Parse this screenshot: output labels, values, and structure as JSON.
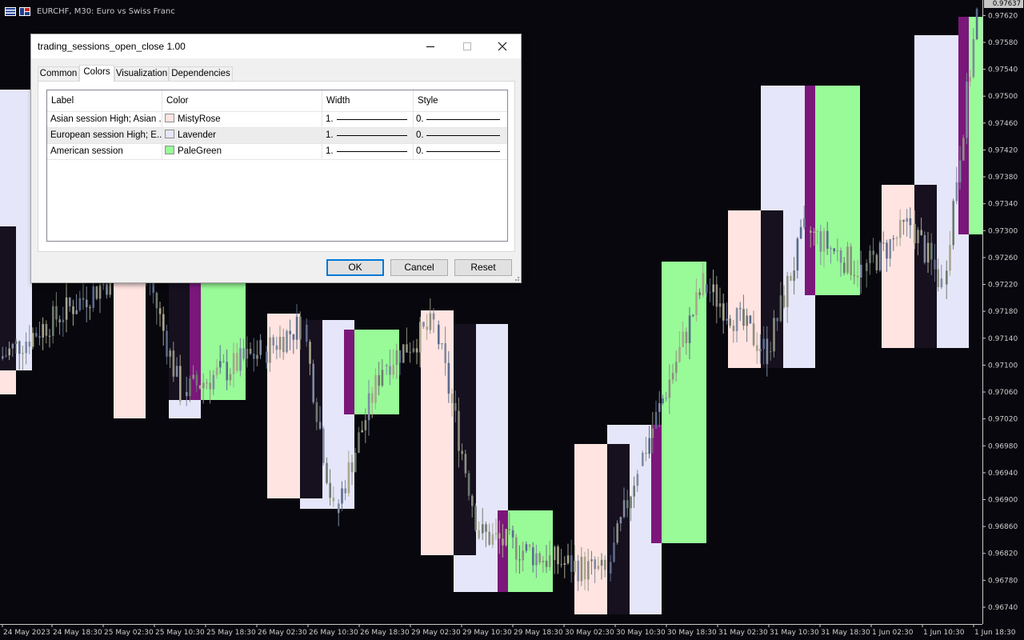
{
  "chart_header": {
    "symbol_text": "EURCHF, M30:  Euro vs Swiss Franc",
    "current_price": "0.97637"
  },
  "chart_data": {
    "type": "candlestick",
    "title": "EURCHF, M30:  Euro vs Swiss Franc",
    "price_range": [
      0.96715,
      0.97643
    ],
    "price_ticks": [
      "0.97620",
      "0.97580",
      "0.97540",
      "0.97500",
      "0.97460",
      "0.97420",
      "0.97380",
      "0.97340",
      "0.97300",
      "0.97260",
      "0.97220",
      "0.97180",
      "0.97140",
      "0.97100",
      "0.97060",
      "0.97020",
      "0.96980",
      "0.96940",
      "0.96900",
      "0.96860",
      "0.96820",
      "0.96780",
      "0.96740"
    ],
    "time_ticks": [
      "24 May 2023",
      "24 May 18:30",
      "25 May 02:30",
      "25 May 10:30",
      "25 May 18:30",
      "26 May 02:30",
      "26 May 10:30",
      "26 May 18:30",
      "29 May 02:30",
      "29 May 10:30",
      "29 May 18:30",
      "30 May 02:30",
      "30 May 10:30",
      "30 May 18:30",
      "31 May 02:30",
      "31 May 10:30",
      "31 May 18:30",
      "1 Jun 02:30",
      "1 Jun 10:30",
      "1 Jun 18:30"
    ],
    "session_colors": {
      "asian": "#FFE4E1",
      "european": "#E6E6FA",
      "american": "#98FB98",
      "overlap": "#16101f",
      "eu_us_overlap": "#7b177b"
    },
    "series": [
      {
        "from": 0,
        "to": 180,
        "open": 0.9711,
        "close": 0.9726
      },
      {
        "from": 180,
        "to": 230,
        "open": 0.9726,
        "close": 0.9706
      },
      {
        "from": 230,
        "to": 330,
        "open": 0.9706,
        "close": 0.9712
      },
      {
        "from": 330,
        "to": 380,
        "open": 0.9712,
        "close": 0.9716
      },
      {
        "from": 380,
        "to": 420,
        "open": 0.9716,
        "close": 0.9688
      },
      {
        "from": 420,
        "to": 480,
        "open": 0.9688,
        "close": 0.971
      },
      {
        "from": 480,
        "to": 545,
        "open": 0.971,
        "close": 0.9716
      },
      {
        "from": 545,
        "to": 600,
        "open": 0.9716,
        "close": 0.9685
      },
      {
        "from": 600,
        "to": 690,
        "open": 0.9685,
        "close": 0.9681
      },
      {
        "from": 690,
        "to": 760,
        "open": 0.9681,
        "close": 0.9679
      },
      {
        "from": 760,
        "to": 800,
        "open": 0.9679,
        "close": 0.9695
      },
      {
        "from": 800,
        "to": 880,
        "open": 0.9695,
        "close": 0.9722
      },
      {
        "from": 880,
        "to": 960,
        "open": 0.9722,
        "close": 0.9712
      },
      {
        "from": 960,
        "to": 1010,
        "open": 0.9712,
        "close": 0.973
      },
      {
        "from": 1010,
        "to": 1080,
        "open": 0.973,
        "close": 0.9724
      },
      {
        "from": 1080,
        "to": 1140,
        "open": 0.9724,
        "close": 0.9731
      },
      {
        "from": 1140,
        "to": 1180,
        "open": 0.9731,
        "close": 0.9722
      },
      {
        "from": 1180,
        "to": 1226,
        "open": 0.9722,
        "close": 0.9762
      }
    ]
  },
  "dialog": {
    "title": "trading_sessions_open_close 1.00",
    "tabs": [
      {
        "label": "Common"
      },
      {
        "label": "Colors"
      },
      {
        "label": "Visualization"
      },
      {
        "label": "Dependencies"
      }
    ],
    "table": {
      "headers": {
        "label": "Label",
        "color": "Color",
        "width": "Width",
        "style": "Style"
      },
      "rows": [
        {
          "label": "Asian session High; Asian ...",
          "color_name": "MistyRose",
          "color_hex": "#FFE4E1",
          "width": "1.",
          "style": "0."
        },
        {
          "label": "European session High; E...",
          "color_name": "Lavender",
          "color_hex": "#E6E6FA",
          "width": "1.",
          "style": "0."
        },
        {
          "label": "American session",
          "color_name": "PaleGreen",
          "color_hex": "#98FB98",
          "width": "1.",
          "style": "0."
        }
      ]
    },
    "buttons": {
      "ok": "OK",
      "cancel": "Cancel",
      "reset": "Reset"
    }
  }
}
